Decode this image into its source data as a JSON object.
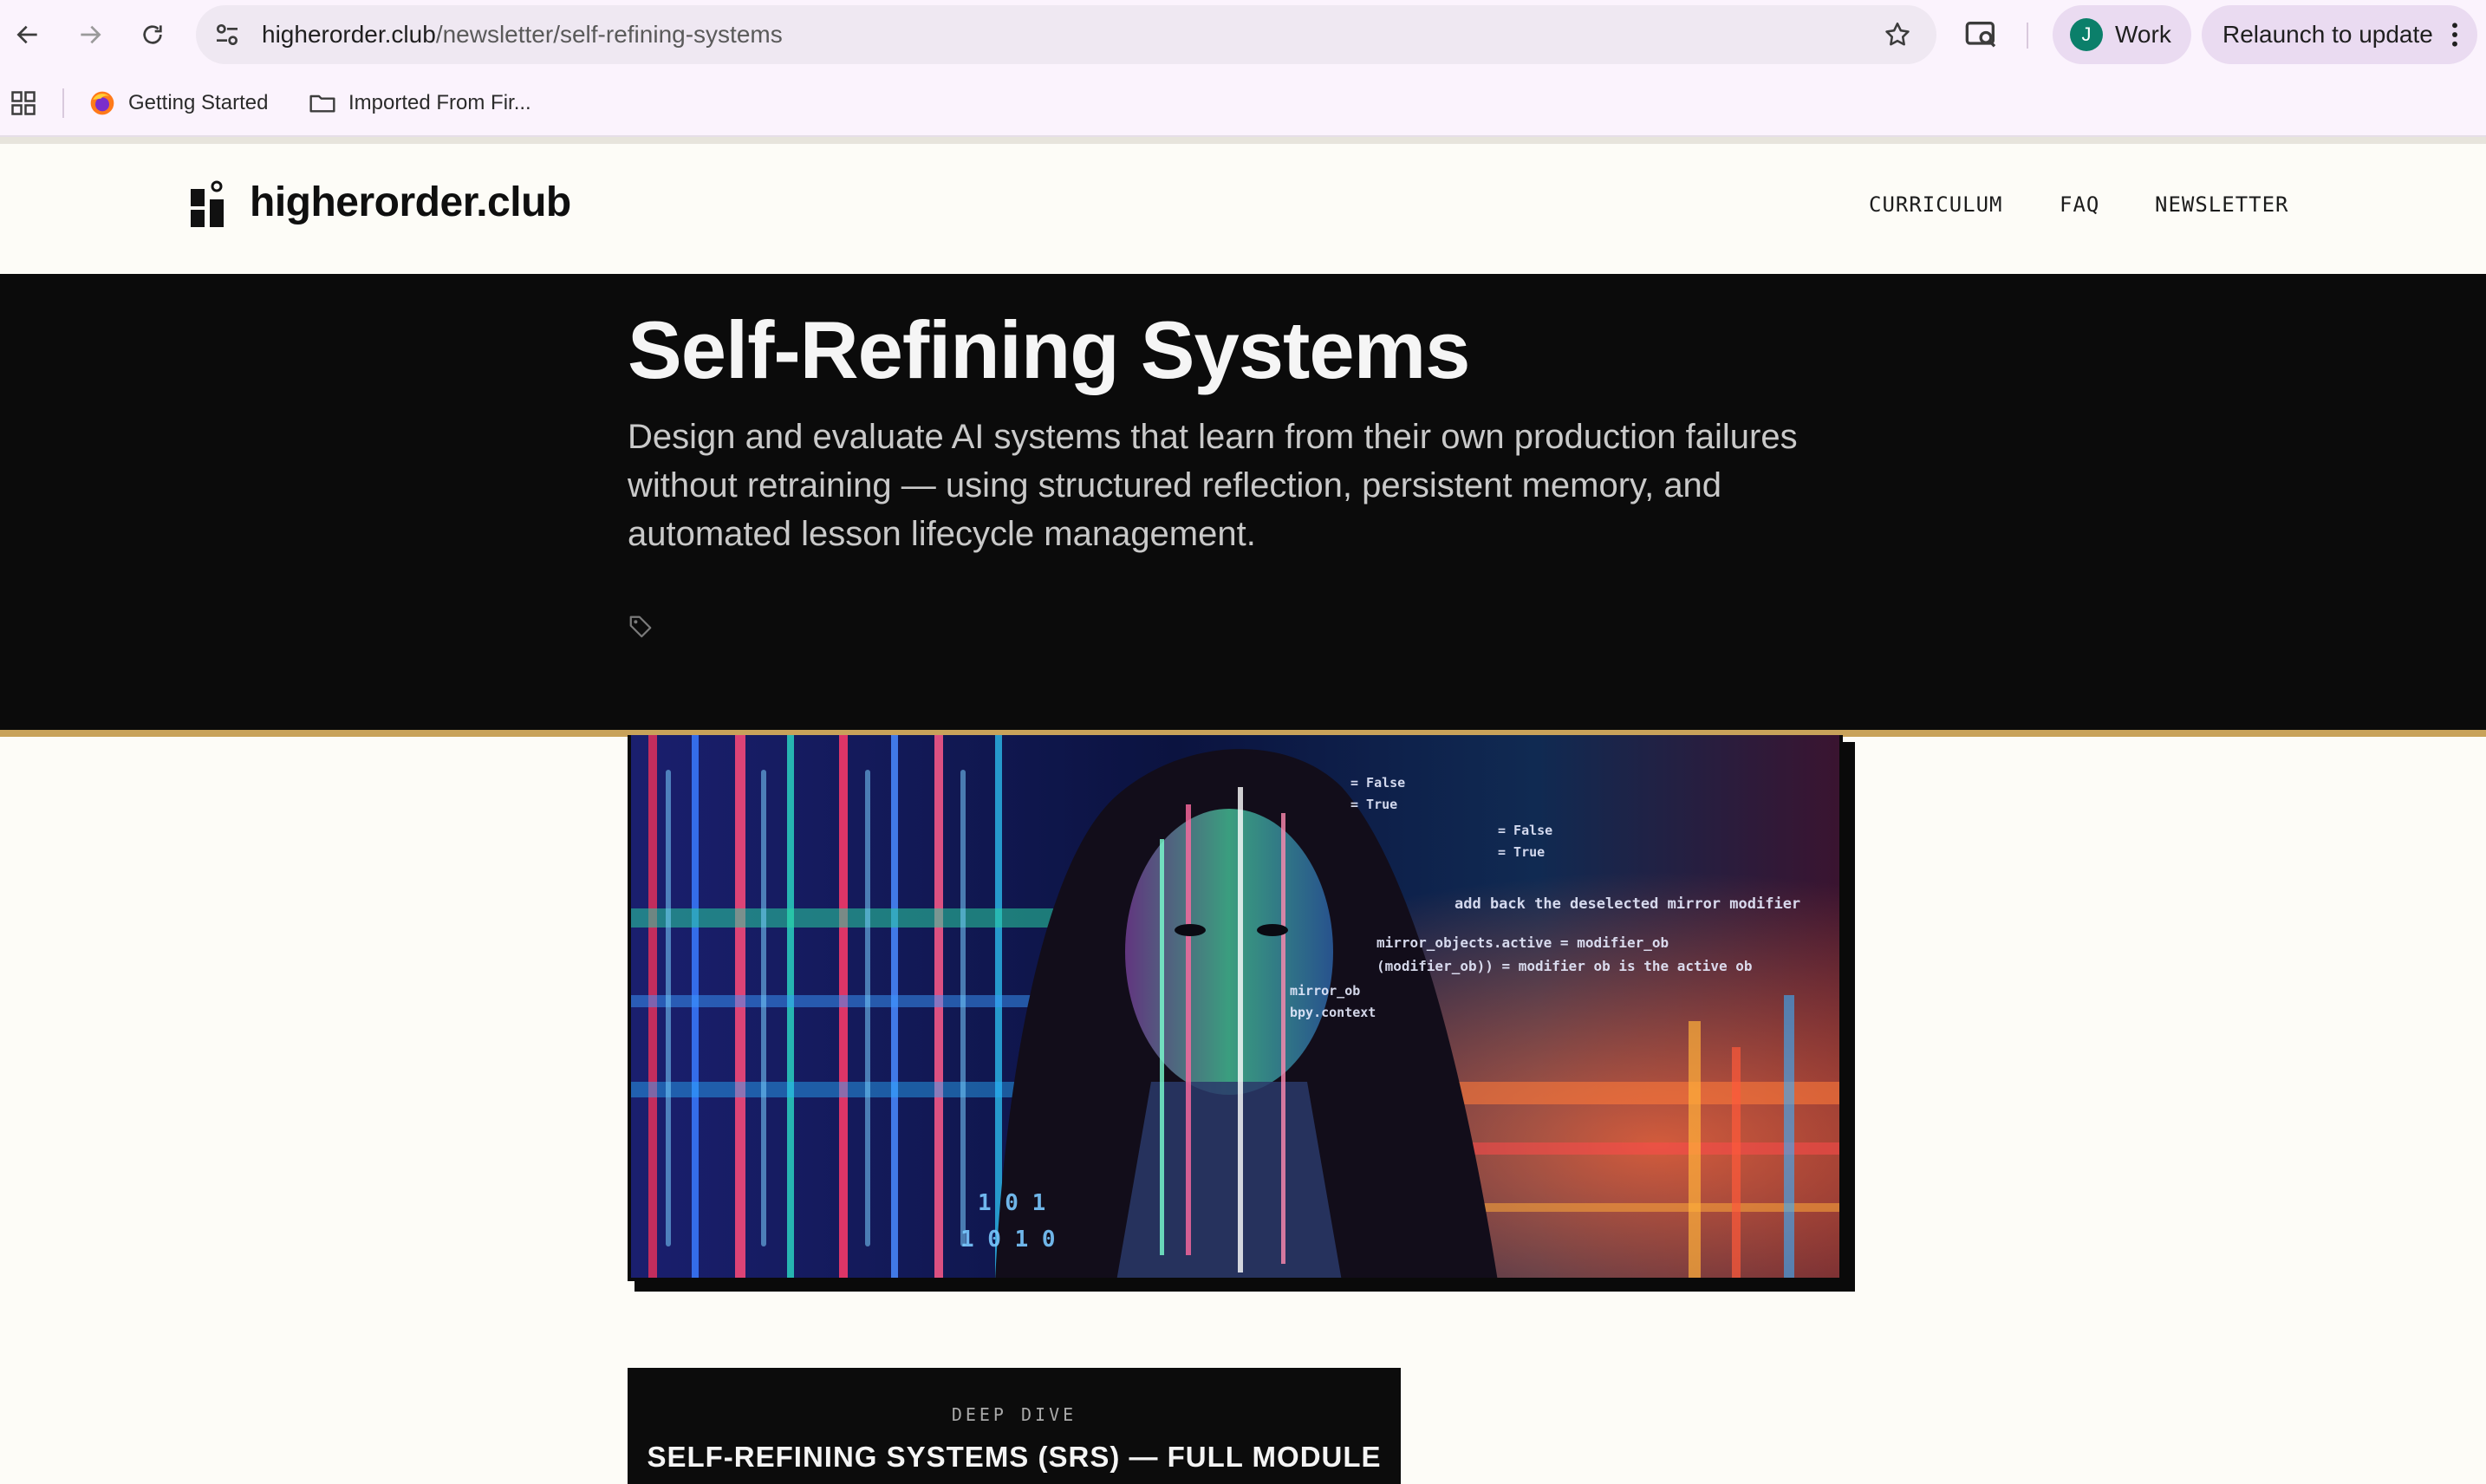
{
  "browser": {
    "url_host": "higherorder.club",
    "url_path": "/newsletter/self-refining-systems",
    "profile_initial": "J",
    "profile_name": "Work",
    "relaunch_label": "Relaunch to update",
    "bookmarks": [
      {
        "label": "Getting Started",
        "icon": "firefox-icon"
      },
      {
        "label": "Imported From Fir...",
        "icon": "folder-icon"
      }
    ],
    "icons": [
      "back-arrow-icon",
      "forward-arrow-icon",
      "reload-icon",
      "site-settings-icon",
      "bookmark-star-icon",
      "google-lens-icon",
      "more-vert-icon",
      "apps-grid-icon"
    ]
  },
  "site": {
    "name": "higherorder.club",
    "nav": [
      "CURRICULUM",
      "FAQ",
      "NEWSLETTER"
    ]
  },
  "hero": {
    "title": "Self-Refining Systems",
    "description": "Design and evaluate AI systems that learn from their own production failures without retraining — using structured reflection, persistent memory, and automated lesson lifecycle management.",
    "icon": "tag-icon"
  },
  "feature_image": {
    "code_lines": [
      "add back the deselected mirror modifier",
      "mirror_objects.active = modifier_ob",
      "(modifier_ob)) = modifier ob is the active ob",
      "= False",
      "= True",
      "mirror_ob",
      "bpy.context",
      "1 0 1",
      "1 0 1 0"
    ]
  },
  "card": {
    "kicker": "DEEP DIVE",
    "title": "SELF-REFINING SYSTEMS (SRS) — FULL MODULE"
  },
  "colors": {
    "accent_gold": "#c8a25a",
    "hero_bg": "#0b0b0b",
    "page_bg": "#fdfcf7",
    "chrome_bg": "#fbf3fd",
    "profile_avatar": "#0b7f6a"
  }
}
